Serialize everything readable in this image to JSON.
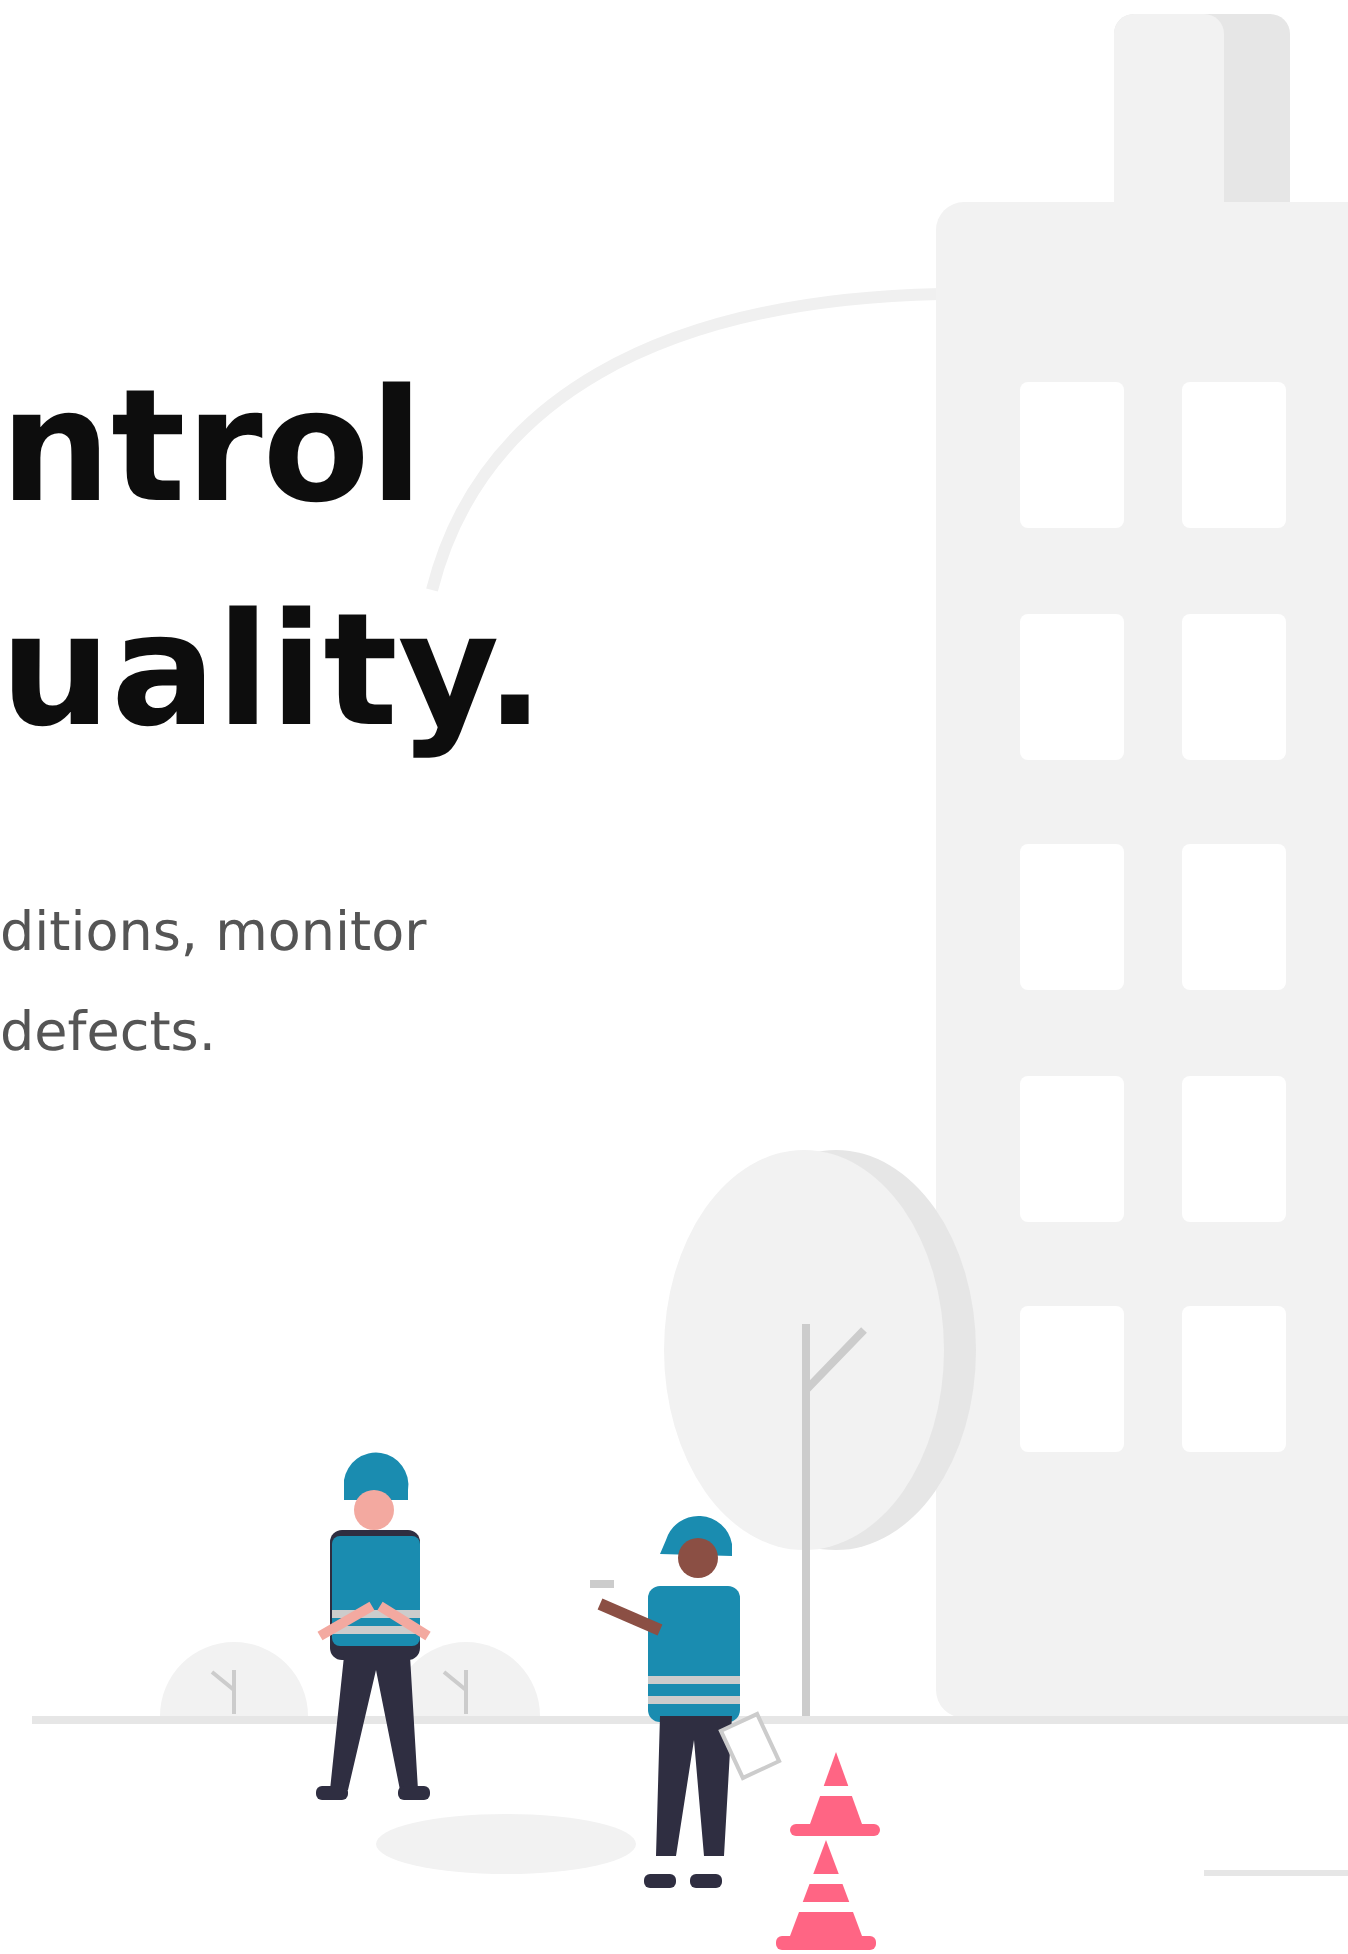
{
  "hero": {
    "heading_lines": [
      "ntrol",
      "uality."
    ],
    "description_lines": [
      "ditions, monitor",
      "defects."
    ]
  }
}
